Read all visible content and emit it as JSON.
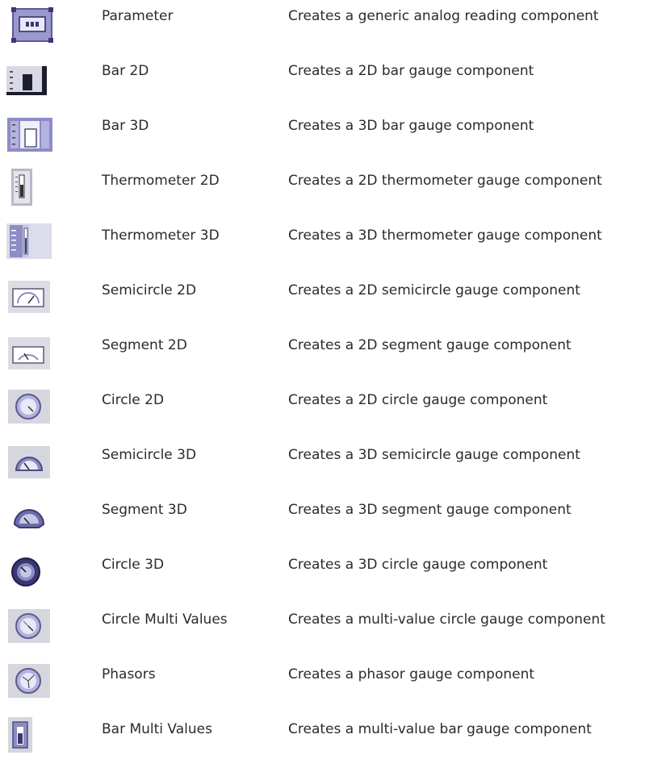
{
  "components": [
    {
      "icon": "parameter-icon",
      "name": "Parameter",
      "description": "Creates a generic analog reading component"
    },
    {
      "icon": "bar-2d-icon",
      "name": "Bar 2D",
      "description": "Creates a 2D bar gauge component"
    },
    {
      "icon": "bar-3d-icon",
      "name": "Bar 3D",
      "description": "Creates a 3D bar gauge component"
    },
    {
      "icon": "thermometer-2d-icon",
      "name": "Thermometer 2D",
      "description": "Creates a 2D thermometer gauge component"
    },
    {
      "icon": "thermometer-3d-icon",
      "name": "Thermometer 3D",
      "description": "Creates a 3D thermometer gauge component"
    },
    {
      "icon": "semicircle-2d-icon",
      "name": "Semicircle 2D",
      "description": "Creates a 2D semicircle gauge component"
    },
    {
      "icon": "segment-2d-icon",
      "name": "Segment 2D",
      "description": "Creates a 2D segment gauge component"
    },
    {
      "icon": "circle-2d-icon",
      "name": "Circle 2D",
      "description": "Creates a 2D circle gauge component"
    },
    {
      "icon": "semicircle-3d-icon",
      "name": "Semicircle 3D",
      "description": "Creates a 3D semicircle gauge component"
    },
    {
      "icon": "segment-3d-icon",
      "name": "Segment 3D",
      "description": "Creates a 3D segment gauge component"
    },
    {
      "icon": "circle-3d-icon",
      "name": "Circle 3D",
      "description": "Creates a 3D circle gauge component"
    },
    {
      "icon": "circle-multi-values-icon",
      "name": "Circle Multi Values",
      "description": "Creates a multi-value circle gauge component"
    },
    {
      "icon": "phasors-icon",
      "name": "Phasors",
      "description": "Creates a phasor gauge component"
    },
    {
      "icon": "bar-multi-values-icon",
      "name": "Bar Multi Values",
      "description": "Creates a multi-value bar gauge component"
    }
  ]
}
